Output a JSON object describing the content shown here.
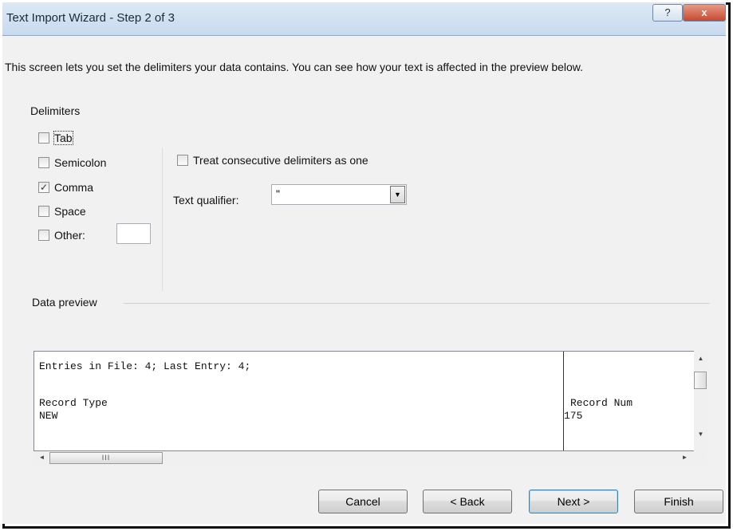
{
  "window": {
    "title": "Text Import Wizard - Step 2 of 3",
    "help_label": "?",
    "close_label": "x"
  },
  "intro_text": "This screen lets you set the delimiters your data contains.  You can see how your text is affected in the preview below.",
  "delimiters": {
    "group_label": "Delimiters",
    "items": [
      {
        "label": "Tab",
        "checked": false,
        "check_mark": ""
      },
      {
        "label": "Semicolon",
        "checked": false,
        "check_mark": ""
      },
      {
        "label": "Comma",
        "checked": true,
        "check_mark": "✓"
      },
      {
        "label": "Space",
        "checked": false,
        "check_mark": ""
      },
      {
        "label": "Other:",
        "checked": false,
        "check_mark": ""
      }
    ],
    "other_value": ""
  },
  "treat_consecutive": {
    "label": "Treat consecutive delimiters as one",
    "checked": false
  },
  "text_qualifier": {
    "label": "Text qualifier:",
    "value": "\""
  },
  "preview": {
    "group_label": "Data preview",
    "lines": [
      "Entries in File: 4; Last Entry: 4;",
      "",
      "Record Type",
      "NEW"
    ],
    "col2_lines": [
      "Record Num",
      "175"
    ]
  },
  "buttons": {
    "cancel": "Cancel",
    "back": "< Back",
    "next": "Next >",
    "finish": "Finish"
  },
  "icons": {
    "scroll_up": "▲",
    "scroll_down": "▼",
    "scroll_left": "◄",
    "scroll_right": "►",
    "dropdown": "▼",
    "thumb_grip": "III"
  }
}
